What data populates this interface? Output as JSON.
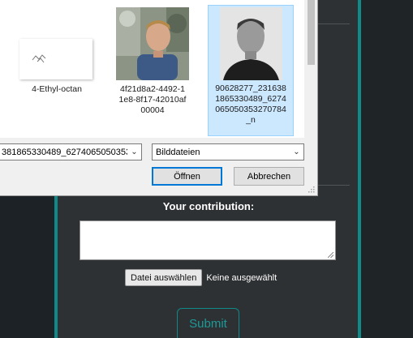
{
  "dialog": {
    "files": [
      {
        "name": "4-Ethyl-octan",
        "thumbnail": "chemical-structure-thumbnail",
        "selected": false
      },
      {
        "name": "4f21d8a2-4492-11e8-8f17-42010af00004",
        "name_lines": [
          "4f21d8a2-4492-1",
          "1e8-8f17-42010af",
          "00004"
        ],
        "thumbnail": "photo-person-outdoors-thumbnail",
        "selected": false
      },
      {
        "name": "90628277_2316381865330489_6274065050353270784_n",
        "name_lines": [
          "90628277_231638",
          "1865330489_6274",
          "065050353270784",
          "_n"
        ],
        "thumbnail": "photo-person-portrait-thumbnail",
        "selected": true
      }
    ],
    "filename_value": "381865330489_6274065050353",
    "filetype_value": "Bilddateien",
    "open_label": "Öffnen",
    "cancel_label": "Abbrechen"
  },
  "page": {
    "contribution_label": "Your contribution:",
    "textarea_value": "",
    "file_button_label": "Datei auswählen",
    "file_status": "Keine ausgewählt",
    "submit_label": "Submit",
    "colors": {
      "accent": "#0f8a88",
      "panel": "#2e3133",
      "background": "#23282b",
      "selection": "#cce8ff"
    }
  }
}
